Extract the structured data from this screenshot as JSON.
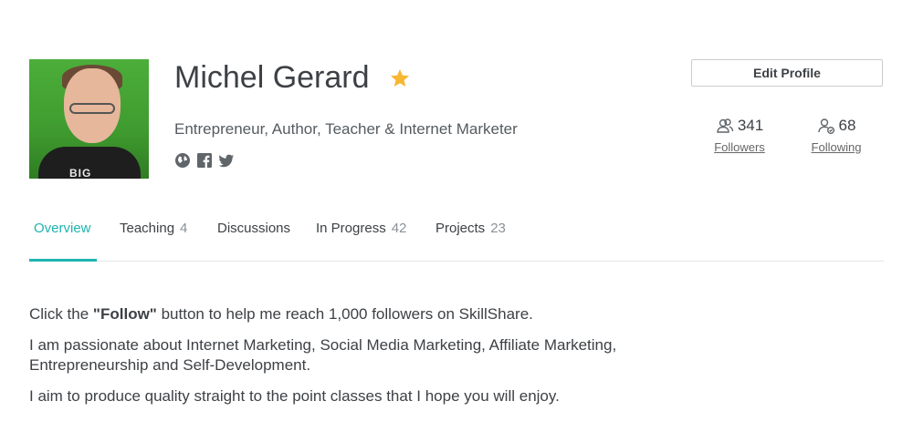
{
  "profile": {
    "name": "Michel Gerard",
    "tagline": "Entrepreneur, Author, Teacher & Internet Marketer",
    "avatar_alt": "BIG",
    "star_color": "#f7b733"
  },
  "socials": [
    {
      "icon": "globe-icon"
    },
    {
      "icon": "facebook-icon"
    },
    {
      "icon": "twitter-icon"
    }
  ],
  "actions": {
    "edit_profile": "Edit Profile"
  },
  "stats": {
    "followers": {
      "count": "341",
      "label": "Followers"
    },
    "following": {
      "count": "68",
      "label": "Following"
    }
  },
  "tabs": [
    {
      "label": "Overview",
      "count": "",
      "active": true
    },
    {
      "label": "Teaching",
      "count": "4"
    },
    {
      "label": "Discussions",
      "count": ""
    },
    {
      "label": "In Progress",
      "count": "42"
    },
    {
      "label": "Projects",
      "count": "23"
    }
  ],
  "bio": {
    "line1_prefix": "Click the ",
    "line1_bold": "\"Follow\"",
    "line1_suffix": " button to help me reach 1,000 followers on SkillShare.",
    "line2": "I am passionate about Internet Marketing, Social Media Marketing, Affiliate Marketing, Entrepreneurship and Self-Development.",
    "line3": "I aim to produce quality straight to the point classes that I hope you will enjoy."
  },
  "colors": {
    "accent": "#1eb4b0",
    "text": "#3d4145"
  }
}
